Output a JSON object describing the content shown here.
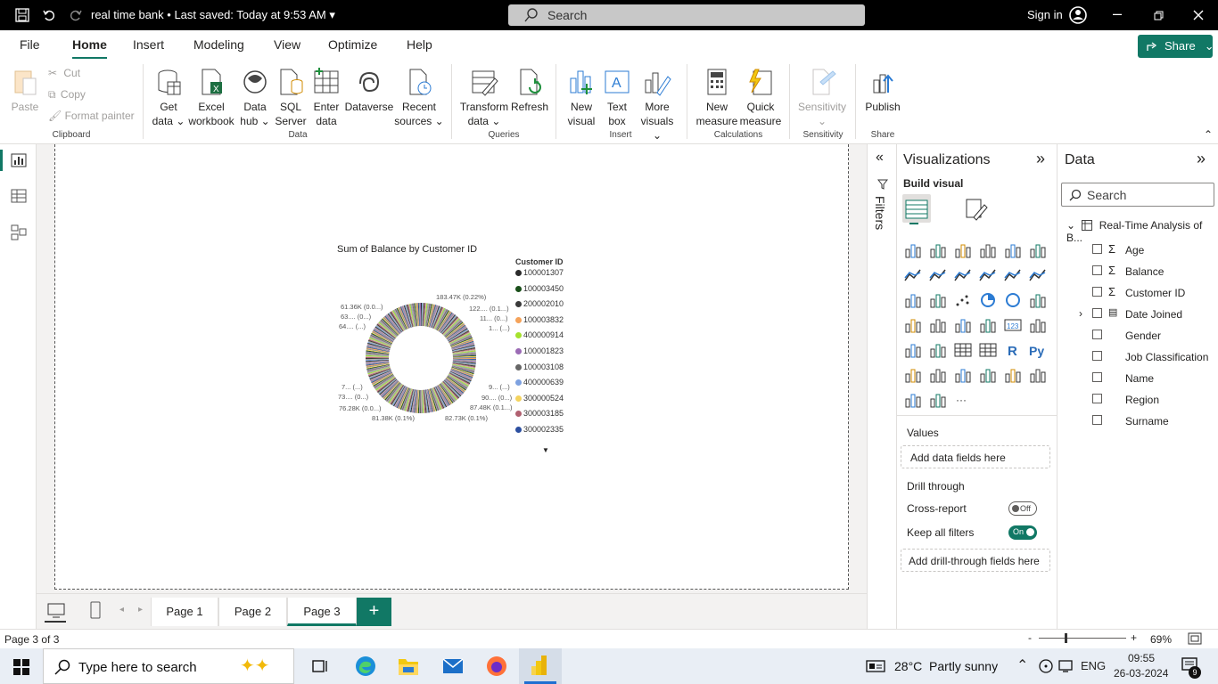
{
  "window": {
    "title": "real time bank",
    "saved": "Last saved: Today at 9:53 AM",
    "search": "Search",
    "signin": "Sign in"
  },
  "menu": [
    "File",
    "Home",
    "Insert",
    "Modeling",
    "View",
    "Optimize",
    "Help"
  ],
  "share": "Share",
  "ribbon": {
    "clipboard": {
      "paste": "Paste",
      "cut": "Cut",
      "copy": "Copy",
      "format_painter": "Format painter",
      "group": "Clipboard"
    },
    "data": {
      "get_data": "Get data",
      "excel": "Excel workbook",
      "data_hub": "Data hub",
      "sql": "SQL Server",
      "enter": "Enter data",
      "dataverse": "Dataverse",
      "recent": "Recent sources",
      "group": "Data"
    },
    "queries": {
      "transform": "Transform data",
      "refresh": "Refresh",
      "group": "Queries"
    },
    "insert": {
      "new_visual": "New visual",
      "text_box": "Text box",
      "more_visuals": "More visuals",
      "group": "Insert"
    },
    "calc": {
      "new_measure": "New measure",
      "quick_measure": "Quick measure",
      "group": "Calculations"
    },
    "sensitivity": {
      "label": "Sensitivity",
      "group": "Sensitivity"
    },
    "share": {
      "publish": "Publish",
      "group": "Share"
    }
  },
  "chart": {
    "title": "Sum of Balance by Customer ID",
    "legend_title": "Customer ID",
    "legend": [
      {
        "id": "100001307",
        "color": "#2b2b2b"
      },
      {
        "id": "100003450",
        "color": "#1a4f1a"
      },
      {
        "id": "200002010",
        "color": "#3a3a3a"
      },
      {
        "id": "100003832",
        "color": "#f5a35a"
      },
      {
        "id": "400000914",
        "color": "#a5e22c"
      },
      {
        "id": "100001823",
        "color": "#9b6bb5"
      },
      {
        "id": "100003108",
        "color": "#666666"
      },
      {
        "id": "400000639",
        "color": "#7da1e0"
      },
      {
        "id": "300000524",
        "color": "#f4d35e"
      },
      {
        "id": "300003185",
        "color": "#b06070"
      },
      {
        "id": "300002335",
        "color": "#2c4fa0"
      }
    ],
    "labels": [
      "183.47K (0.22%)",
      "122.... (0.1...)",
      "11... (0...)",
      "1... (...)",
      "61.36K (0.0...)",
      "63.... (0...)",
      "64.... (...)",
      "7... (...)",
      "73.... (0...)",
      "76.28K (0.0...)",
      "81.38K (0.1%)",
      "82.73K (0.1%)",
      "87.48K (0.1...)",
      "90.... (0...)",
      "9... (...)"
    ]
  },
  "chart_data": {
    "type": "pie",
    "title": "Sum of Balance by Customer ID",
    "legend_title": "Customer ID",
    "categories": [
      "100001307",
      "100003450",
      "200002010",
      "100003832",
      "400000914",
      "100001823",
      "100003108",
      "400000639",
      "300000524",
      "300003185",
      "300002335"
    ],
    "annotations": [
      "183.47K (0.22%)",
      "61.36K (0.0...)",
      "76.28K (0.0...)",
      "81.38K (0.1%)",
      "82.73K (0.1%)",
      "87.48K (0.1...)"
    ]
  },
  "filters_label": "Filters",
  "viz": {
    "title": "Visualizations",
    "build": "Build visual",
    "values": "Values",
    "add_data": "Add data fields here",
    "drill": "Drill through",
    "cross": "Cross-report",
    "cross_state": "Off",
    "keep": "Keep all filters",
    "keep_state": "On",
    "add_drill": "Add drill-through fields here"
  },
  "data": {
    "title": "Data",
    "search": "Search",
    "table": "Real-Time Analysis of B...",
    "fields": [
      {
        "name": "Age",
        "sigma": true
      },
      {
        "name": "Balance",
        "sigma": true
      },
      {
        "name": "Customer ID",
        "sigma": true
      },
      {
        "name": "Date Joined",
        "date": true
      },
      {
        "name": "Gender"
      },
      {
        "name": "Job Classification"
      },
      {
        "name": "Name"
      },
      {
        "name": "Region"
      },
      {
        "name": "Surname"
      }
    ]
  },
  "pages": [
    "Page 1",
    "Page 2",
    "Page 3"
  ],
  "status": {
    "page": "Page 3 of 3",
    "zoom": "69%"
  },
  "taskbar": {
    "search": "Type here to search",
    "weather": "28°C  Partly sunny",
    "lang": "ENG",
    "time": "09:55",
    "date": "26-03-2024",
    "notif": "9"
  }
}
